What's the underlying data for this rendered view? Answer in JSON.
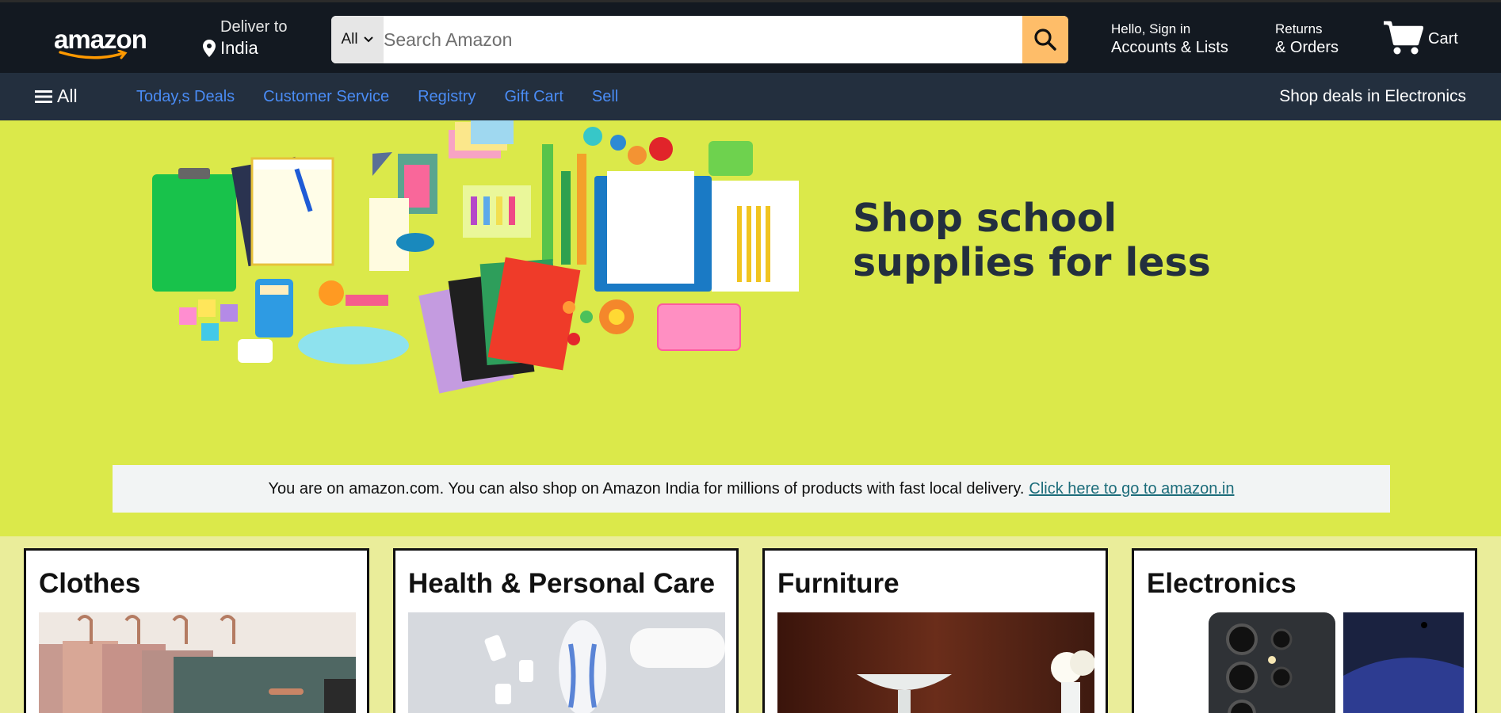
{
  "header": {
    "logo_text": "amazon",
    "deliver_small": "Deliver to",
    "deliver_country": "India",
    "search_category": "All",
    "search_placeholder": "Search Amazon",
    "account_small": "Hello, Sign in",
    "account_big": "Accounts & Lists",
    "returns_small": "Returns",
    "returns_big": "& Orders",
    "cart_label": "Cart"
  },
  "nav": {
    "all_label": "All",
    "links": [
      "Today,s Deals",
      "Customer Service",
      "Registry",
      "Gift Cart",
      "Sell"
    ],
    "right_label": "Shop deals in Electronics"
  },
  "hero": {
    "title_line1": "Shop school",
    "title_line2": "supplies for less",
    "notice_text": "You are on amazon.com. You can also shop on Amazon India for millions of products with fast local delivery.",
    "notice_link": "Click here to go to amazon.in"
  },
  "cards": [
    {
      "title": "Clothes"
    },
    {
      "title": "Health & Personal Care"
    },
    {
      "title": "Furniture"
    },
    {
      "title": "Electronics"
    }
  ],
  "colors": {
    "header_bg": "#131921",
    "nav_bg": "#232f3e",
    "search_button": "#febd69",
    "hero_bg": "#dbe94a",
    "link_blue": "#4a8cf5"
  }
}
